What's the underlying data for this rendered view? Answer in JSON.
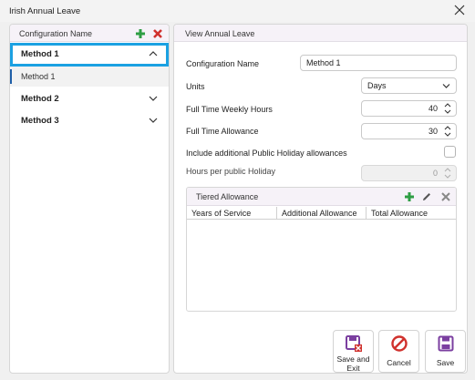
{
  "window": {
    "title": "Irish Annual Leave"
  },
  "left_panel": {
    "header": "Configuration Name",
    "methods": [
      {
        "label": "Method 1",
        "expanded": true,
        "sub_items": [
          "Method 1"
        ]
      },
      {
        "label": "Method 2",
        "expanded": false
      },
      {
        "label": "Method 3",
        "expanded": false
      }
    ]
  },
  "right_panel": {
    "header": "View Annual Leave",
    "fields": {
      "configuration_name": {
        "label": "Configuration Name",
        "value": "Method 1"
      },
      "units": {
        "label": "Units",
        "value": "Days"
      },
      "full_time_weekly_hours": {
        "label": "Full Time Weekly Hours",
        "value": "40"
      },
      "full_time_allowance": {
        "label": "Full Time Allowance",
        "value": "30"
      },
      "include_public_holiday": {
        "label": "Include additional Public Holiday allowances",
        "checked": false
      },
      "hours_per_public_holiday": {
        "label": "Hours per public Holiday",
        "value": "0"
      }
    },
    "tiered_allowance": {
      "title": "Tiered Allowance",
      "columns": [
        "Years of Service",
        "Additional Allowance",
        "Total Allowance"
      ],
      "rows": []
    }
  },
  "actions": {
    "save_and_exit": "Save and Exit",
    "cancel": "Cancel",
    "save": "Save"
  },
  "colors": {
    "selection_outline": "#1ba1e2",
    "add_green": "#2e9e44",
    "delete_red": "#d0312d",
    "save_purple": "#7b3fa0"
  }
}
